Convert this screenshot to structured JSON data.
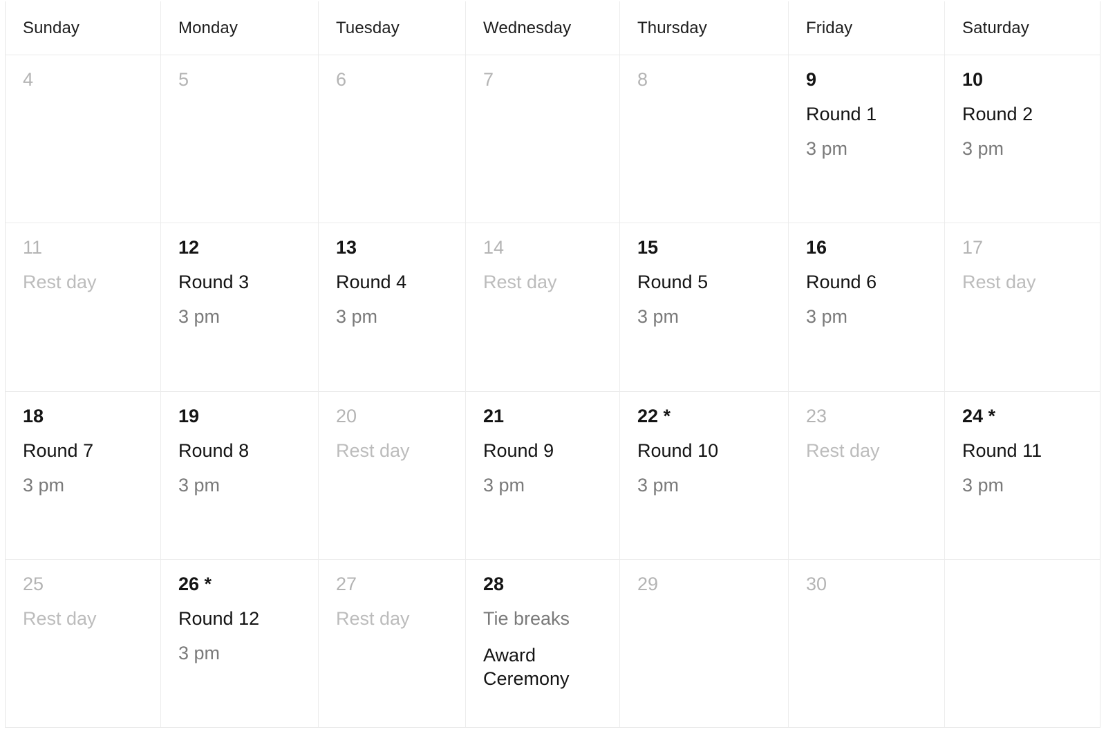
{
  "calendar": {
    "day_headers": [
      "Sunday",
      "Monday",
      "Tuesday",
      "Wednesday",
      "Thursday",
      "Friday",
      "Saturday"
    ],
    "colors": {
      "text_primary": "#141414",
      "text_muted": "#7a7a7a",
      "text_rest": "#bcbcbc",
      "date_inactive": "#b4b4b4",
      "grid_line": "#ececec"
    },
    "weeks": [
      [
        {
          "date": "4",
          "active": false,
          "lines": []
        },
        {
          "date": "5",
          "active": false,
          "lines": []
        },
        {
          "date": "6",
          "active": false,
          "lines": []
        },
        {
          "date": "7",
          "active": false,
          "lines": []
        },
        {
          "date": "8",
          "active": false,
          "lines": []
        },
        {
          "date": "9",
          "active": true,
          "lines": [
            {
              "text": "Round 1",
              "style": "primary"
            },
            {
              "text": "3 pm",
              "style": "muted"
            }
          ]
        },
        {
          "date": "10",
          "active": true,
          "lines": [
            {
              "text": "Round 2",
              "style": "primary"
            },
            {
              "text": "3 pm",
              "style": "muted"
            }
          ]
        }
      ],
      [
        {
          "date": "11",
          "active": false,
          "lines": [
            {
              "text": "Rest day",
              "style": "rest"
            }
          ]
        },
        {
          "date": "12",
          "active": true,
          "lines": [
            {
              "text": "Round 3",
              "style": "primary"
            },
            {
              "text": "3 pm",
              "style": "muted"
            }
          ]
        },
        {
          "date": "13",
          "active": true,
          "lines": [
            {
              "text": "Round 4",
              "style": "primary"
            },
            {
              "text": "3 pm",
              "style": "muted"
            }
          ]
        },
        {
          "date": "14",
          "active": false,
          "lines": [
            {
              "text": "Rest day",
              "style": "rest"
            }
          ]
        },
        {
          "date": "15",
          "active": true,
          "lines": [
            {
              "text": "Round 5",
              "style": "primary"
            },
            {
              "text": "3 pm",
              "style": "muted"
            }
          ]
        },
        {
          "date": "16",
          "active": true,
          "lines": [
            {
              "text": "Round 6",
              "style": "primary"
            },
            {
              "text": "3 pm",
              "style": "muted"
            }
          ]
        },
        {
          "date": "17",
          "active": false,
          "lines": [
            {
              "text": "Rest day",
              "style": "rest"
            }
          ]
        }
      ],
      [
        {
          "date": "18",
          "active": true,
          "lines": [
            {
              "text": "Round 7",
              "style": "primary"
            },
            {
              "text": "3 pm",
              "style": "muted"
            }
          ]
        },
        {
          "date": "19",
          "active": true,
          "lines": [
            {
              "text": "Round 8",
              "style": "primary"
            },
            {
              "text": "3 pm",
              "style": "muted"
            }
          ]
        },
        {
          "date": "20",
          "active": false,
          "lines": [
            {
              "text": "Rest day",
              "style": "rest"
            }
          ]
        },
        {
          "date": "21",
          "active": true,
          "lines": [
            {
              "text": "Round 9",
              "style": "primary"
            },
            {
              "text": "3 pm",
              "style": "muted"
            }
          ]
        },
        {
          "date": "22 *",
          "active": true,
          "lines": [
            {
              "text": "Round 10",
              "style": "primary"
            },
            {
              "text": "3 pm",
              "style": "muted"
            }
          ]
        },
        {
          "date": "23",
          "active": false,
          "lines": [
            {
              "text": "Rest day",
              "style": "rest"
            }
          ]
        },
        {
          "date": "24 *",
          "active": true,
          "lines": [
            {
              "text": "Round 11",
              "style": "primary"
            },
            {
              "text": "3 pm",
              "style": "muted"
            }
          ]
        }
      ],
      [
        {
          "date": "25",
          "active": false,
          "lines": [
            {
              "text": "Rest day",
              "style": "rest"
            }
          ]
        },
        {
          "date": "26 *",
          "active": true,
          "lines": [
            {
              "text": "Round 12",
              "style": "primary"
            },
            {
              "text": "3 pm",
              "style": "muted"
            }
          ]
        },
        {
          "date": "27",
          "active": false,
          "lines": [
            {
              "text": "Rest day",
              "style": "rest"
            }
          ]
        },
        {
          "date": "28",
          "active": true,
          "lines": [
            {
              "text": "Tie breaks",
              "style": "muted"
            },
            {
              "text": "Award Ceremony",
              "style": "primary",
              "wrap": true
            }
          ]
        },
        {
          "date": "29",
          "active": false,
          "lines": []
        },
        {
          "date": "30",
          "active": false,
          "lines": []
        },
        {
          "date": "",
          "active": false,
          "lines": []
        }
      ]
    ]
  }
}
